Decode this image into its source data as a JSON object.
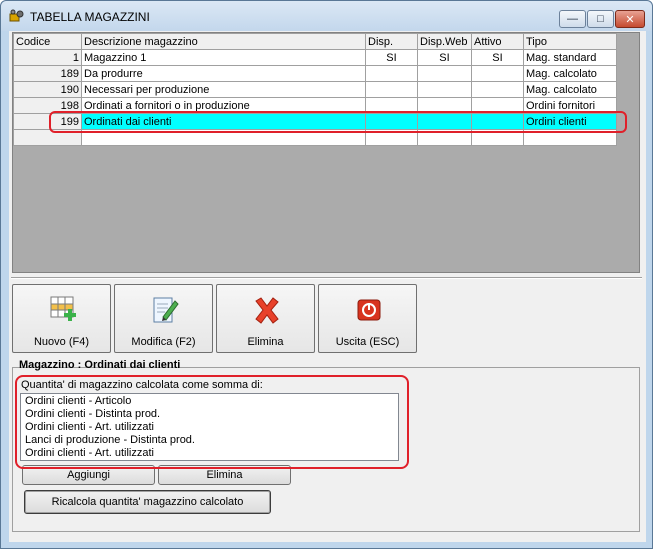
{
  "window": {
    "title": "TABELLA MAGAZZINI",
    "controls": {
      "minimize": "—",
      "maximize": "□",
      "close": "✕"
    }
  },
  "grid": {
    "columns": [
      "Codice",
      "Descrizione magazzino",
      "Disp.",
      "Disp.Web",
      "Attivo",
      "Tipo"
    ],
    "rows": [
      {
        "codice": "1",
        "descrizione": "Magazzino 1",
        "disp": "SI",
        "disp_web": "SI",
        "attivo": "SI",
        "tipo": "Mag. standard"
      },
      {
        "codice": "189",
        "descrizione": "Da produrre",
        "disp": "",
        "disp_web": "",
        "attivo": "",
        "tipo": "Mag. calcolato"
      },
      {
        "codice": "190",
        "descrizione": "Necessari per produzione",
        "disp": "",
        "disp_web": "",
        "attivo": "",
        "tipo": "Mag. calcolato"
      },
      {
        "codice": "198",
        "descrizione": "Ordinati a fornitori o in produzione",
        "disp": "",
        "disp_web": "",
        "attivo": "",
        "tipo": "Ordini fornitori"
      },
      {
        "codice": "199",
        "descrizione": "Ordinati dai clienti",
        "disp": "",
        "disp_web": "",
        "attivo": "",
        "tipo": "Ordini clienti"
      }
    ],
    "selected_row_color": "#00ffff"
  },
  "toolbar": {
    "buttons": [
      {
        "label": "Nuovo (F4)",
        "icon": "new-grid-icon"
      },
      {
        "label": "Modifica (F2)",
        "icon": "edit-document-icon"
      },
      {
        "label": "Elimina",
        "icon": "delete-x-icon"
      },
      {
        "label": "Uscita (ESC)",
        "icon": "power-exit-icon"
      }
    ]
  },
  "detail": {
    "section_title": "Magazzino : Ordinati dai clienti",
    "calc_label": "Quantita' di magazzino calcolata come somma di:",
    "items": [
      "Ordini clienti - Articolo",
      "Ordini clienti - Distinta prod.",
      "Ordini clienti - Art. utilizzati",
      "Lanci di produzione - Distinta prod.",
      "Ordini clienti - Art. utilizzati"
    ],
    "add_label": "Aggiungi",
    "delete_label": "Elimina",
    "recalc_label": "Ricalcola quantita' magazzino calcolato"
  },
  "colors": {
    "highlight": "#e0202a",
    "window_frame": "#bfd6ec"
  }
}
